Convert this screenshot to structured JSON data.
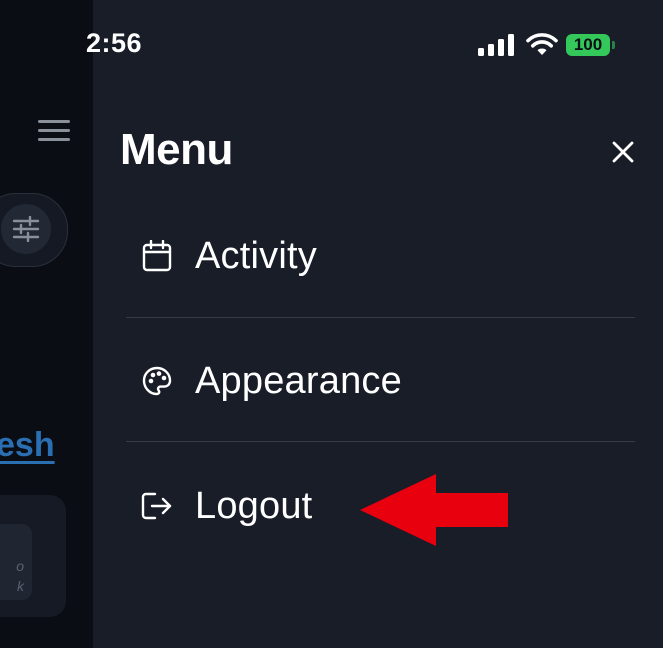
{
  "status_bar": {
    "time": "2:56",
    "battery": "100"
  },
  "background_app": {
    "refresh_label": "esh",
    "card_text": "o\nk"
  },
  "menu": {
    "title": "Menu",
    "items": [
      {
        "label": "Activity",
        "icon": "calendar-icon"
      },
      {
        "label": "Appearance",
        "icon": "palette-icon"
      },
      {
        "label": "Logout",
        "icon": "logout-icon"
      }
    ]
  },
  "colors": {
    "panel": "#181d28",
    "battery": "#34c759",
    "annotation_arrow": "#e8000f",
    "link": "#2b6fb3"
  }
}
